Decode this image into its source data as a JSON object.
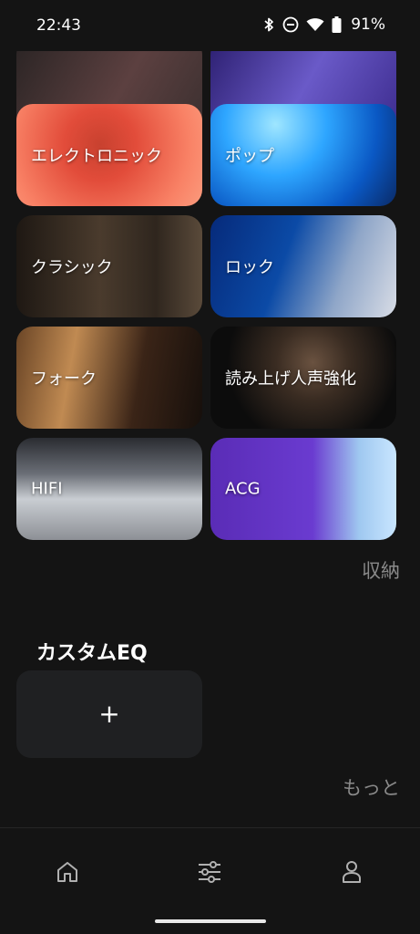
{
  "status_bar": {
    "time": "22:43",
    "battery": "91%",
    "icons": [
      "bluetooth-icon",
      "dnd-icon",
      "wifi-icon",
      "battery-icon"
    ]
  },
  "presets": [
    {
      "id": "top-left-partial",
      "label": "",
      "colors": [
        "#3a2f2f",
        "#5c4040"
      ]
    },
    {
      "id": "top-right-partial",
      "label": "",
      "colors": [
        "#3b2a8c",
        "#7b6bd6"
      ]
    },
    {
      "id": "electronic",
      "label": "エレクトロニック",
      "colors": [
        "#f7765a",
        "#e24c3a"
      ]
    },
    {
      "id": "pop",
      "label": "ポップ",
      "colors": [
        "#0a2a66",
        "#2ea6ff"
      ]
    },
    {
      "id": "classic",
      "label": "クラシック",
      "colors": [
        "#2a231d",
        "#4a3b2d"
      ]
    },
    {
      "id": "rock",
      "label": "ロック",
      "colors": [
        "#0b2a6a",
        "#bcc6d8"
      ]
    },
    {
      "id": "folk",
      "label": "フォーク",
      "colors": [
        "#2b1a12",
        "#8a5a2c"
      ]
    },
    {
      "id": "vocal",
      "label": "読み上げ人声強化",
      "colors": [
        "#0c0c0c",
        "#4a3a2c"
      ]
    },
    {
      "id": "hifi",
      "label": "HIFI",
      "colors": [
        "#4a4d55",
        "#cfd3d8"
      ]
    },
    {
      "id": "acg",
      "label": "ACG",
      "colors": [
        "#5c2fb8",
        "#7a4fe0"
      ]
    }
  ],
  "collapse_label": "収納",
  "custom_eq": {
    "title": "カスタムEQ",
    "add_symbol": "+"
  },
  "more_label": "もっと",
  "bottom_nav": [
    "home-icon",
    "equalizer-icon",
    "profile-icon"
  ]
}
